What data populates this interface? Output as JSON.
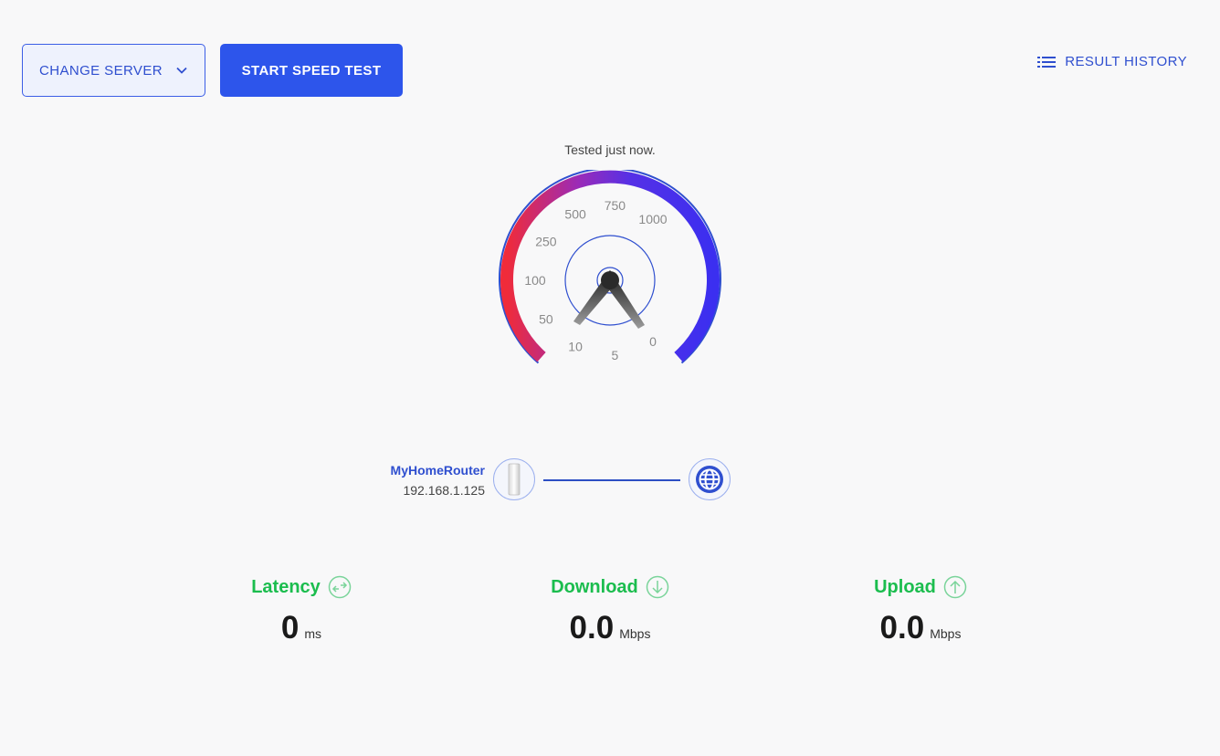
{
  "toolbar": {
    "change_server_label": "CHANGE SERVER",
    "start_label": "START SPEED TEST",
    "history_label": "RESULT HISTORY"
  },
  "status": {
    "tested_text": "Tested just now."
  },
  "gauge": {
    "ticks": [
      "0",
      "5",
      "10",
      "50",
      "100",
      "250",
      "500",
      "750",
      "1000"
    ],
    "current_value": 0,
    "colors": {
      "low": "#f02b3a",
      "high": "#3b2ff0",
      "ring": "#2f4fcf"
    }
  },
  "connection": {
    "router_name": "MyHomeRouter",
    "router_ip": "192.168.1.125",
    "router_icon": "router-icon",
    "internet_icon": "globe-icon"
  },
  "metrics": {
    "latency": {
      "label": "Latency",
      "value": "0",
      "unit": "ms",
      "icon": "latency-icon"
    },
    "download": {
      "label": "Download",
      "value": "0.0",
      "unit": "Mbps",
      "icon": "download-arrow-icon"
    },
    "upload": {
      "label": "Upload",
      "value": "0.0",
      "unit": "Mbps",
      "icon": "upload-arrow-icon"
    }
  },
  "theme": {
    "accent": "#2d55eb",
    "success": "#1bbd4e"
  }
}
